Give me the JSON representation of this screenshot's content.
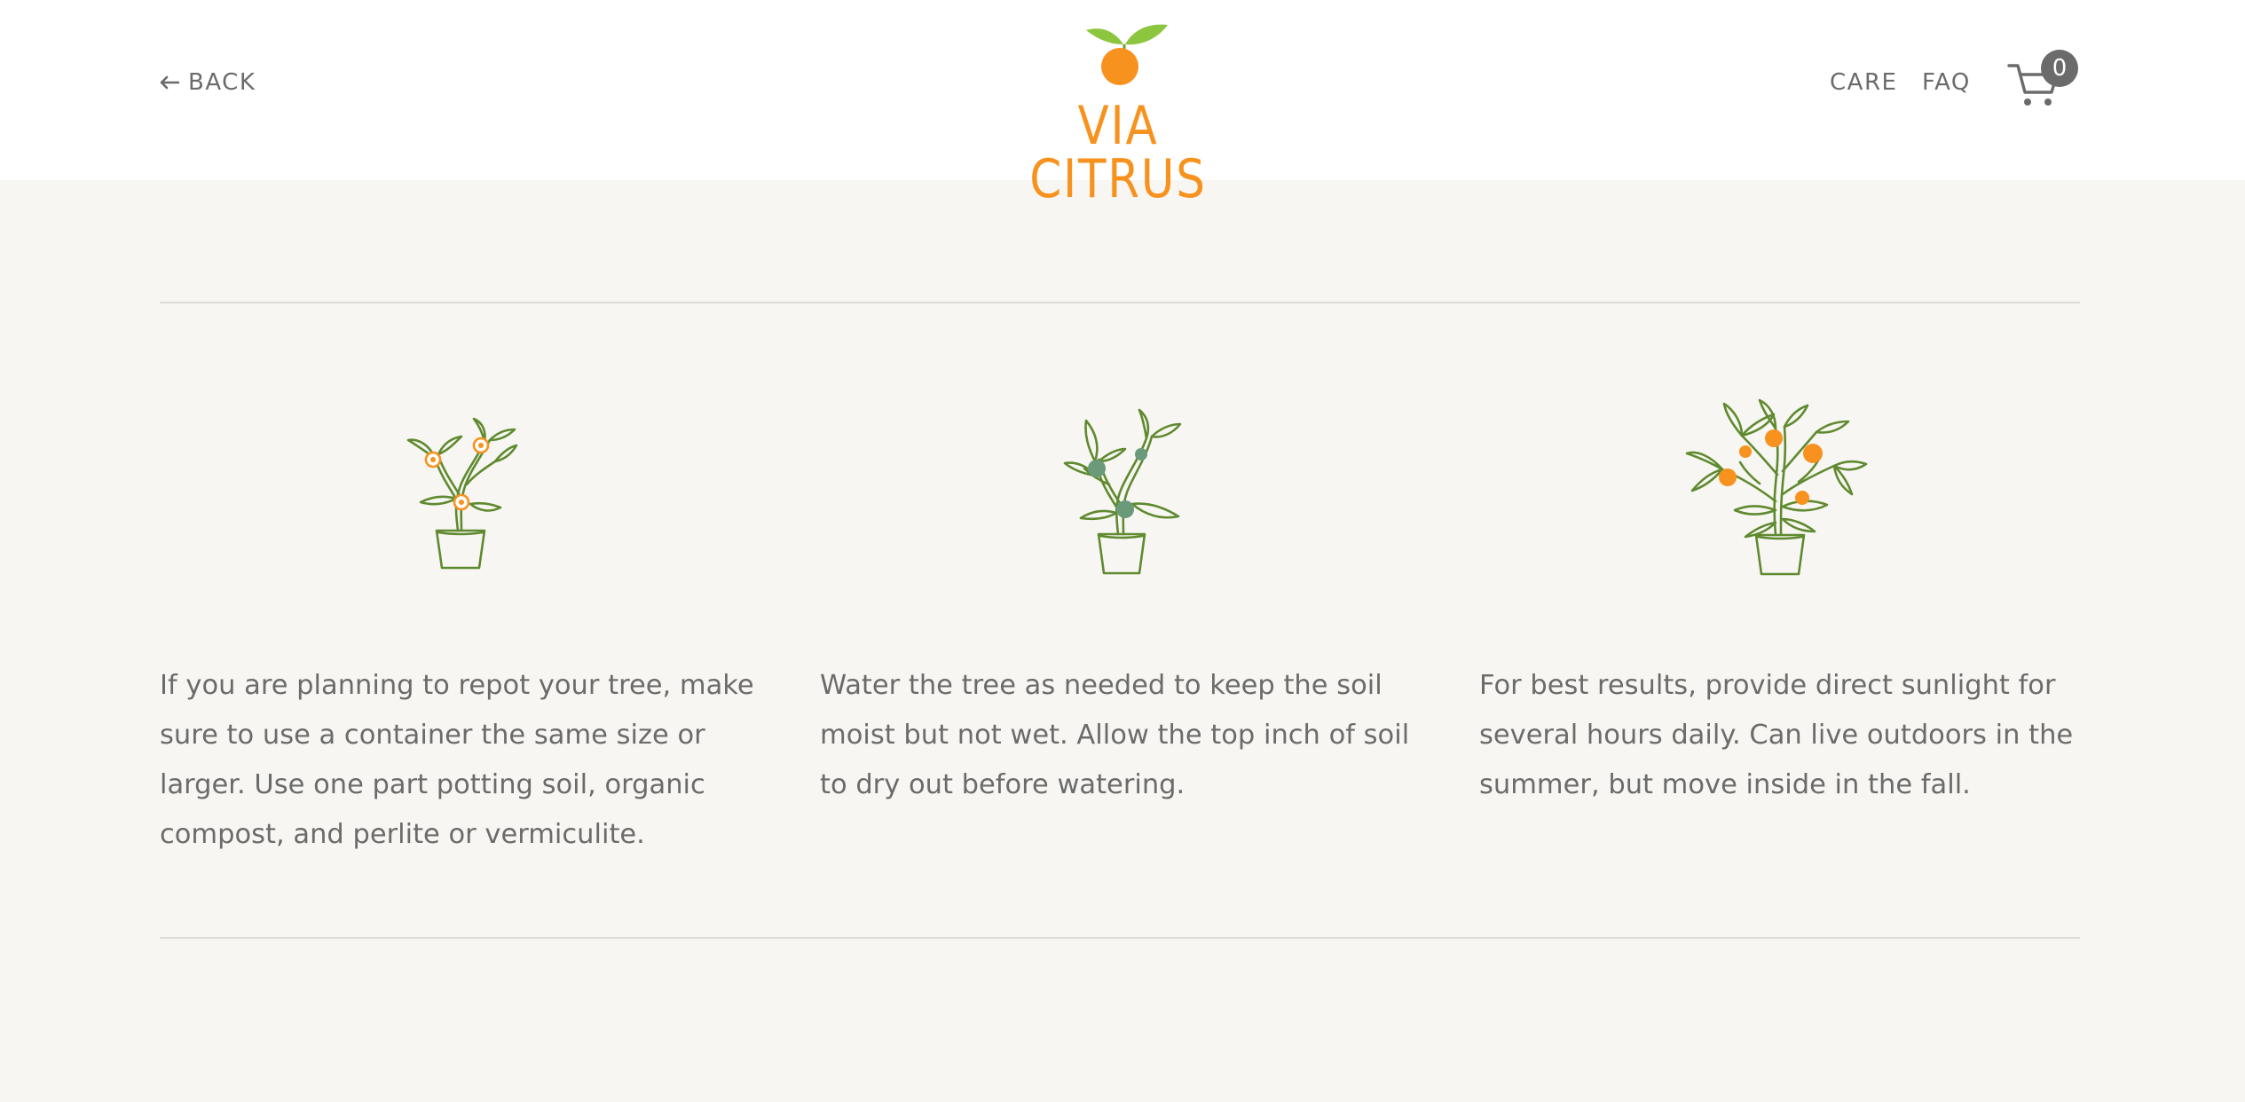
{
  "header": {
    "back_label": "BACK",
    "logo_text": "VIA CITRUS",
    "nav": {
      "care_label": "CARE",
      "faq_label": "FAQ"
    },
    "cart_count": "0"
  },
  "columns": [
    {
      "icon": "flowering-plant-icon",
      "text": "If you are planning to repot your tree, make sure to use a container the same size or larger. Use one part potting soil, organic compost, and perlite or vermiculite."
    },
    {
      "icon": "green-fruit-plant-icon",
      "text": "Water the tree as needed to keep the soil moist but not wet. Allow the top inch of soil to dry out before watering."
    },
    {
      "icon": "orange-fruit-tree-icon",
      "text": "For best results, provide direct sunlight for several hours daily. Can live outdoors in the summer, but move inside in the fall."
    }
  ],
  "colors": {
    "brand_orange": "#f7921e",
    "leaf_green": "#8cc63f",
    "plant_stroke": "#5f8a2f",
    "fruit_green": "#6a9a7a",
    "text_gray": "#6b6b6b",
    "page_bg": "#f7f6f2",
    "divider": "#dcdcda"
  }
}
